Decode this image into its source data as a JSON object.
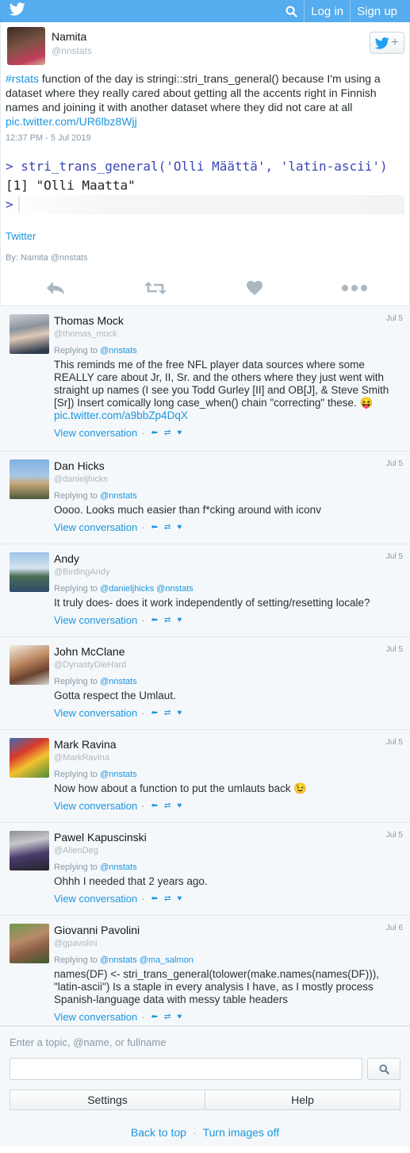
{
  "topbar": {
    "logo_icon": "twitter-bird-icon",
    "search_icon": "search-icon",
    "login_label": "Log in",
    "signup_label": "Sign up"
  },
  "tweet": {
    "author_name": "Namita",
    "author_handle": "@nnstats",
    "text_hashtag": "#rstats",
    "text_body": " function of the day is stringi::stri_trans_general() because I'm using a dataset where they really cared about getting all the accents right in Finnish names and joining it with another dataset where they did not care at all ",
    "text_link": "pic.twitter.com/UR6lbz8Wjj",
    "time": "12:37 PM - 5 Jul 2019",
    "code_lines": [
      "> stri_trans_general('Olli Määttä', 'latin-ascii')",
      "[1] \"Olli Maatta\"",
      ">"
    ],
    "source_link": "Twitter",
    "by_prefix": "By: ",
    "by_name": "Namita",
    "by_handle": "@nnstats"
  },
  "replies": [
    {
      "name": "Thomas Mock",
      "handle": "@thomas_mock",
      "date": "Jul 5",
      "replying_prefix": "Replying to ",
      "replying_to": "@nnstats",
      "text": "This reminds me of the free NFL player data sources where some REALLY care about Jr, II, Sr. and the others where they just went with straight up names (I see you Todd Gurley [II] and OB[J], & Steve Smith [Sr]) Insert comically long case_when() chain \"correcting\" these. 😝",
      "link": "pic.twitter.com/a9bbZp4DqX",
      "view_conversation": "View conversation"
    },
    {
      "name": "Dan Hicks",
      "handle": "@danieljhicks",
      "date": "Jul 5",
      "replying_prefix": "Replying to ",
      "replying_to": "@nnstats",
      "text": "Oooo. Looks much easier than f*cking around with iconv",
      "link": "",
      "view_conversation": "View conversation"
    },
    {
      "name": "Andy",
      "handle": "@BirdingAndy",
      "date": "Jul 5",
      "replying_prefix": "Replying to ",
      "replying_to": "@danieljhicks @nnstats",
      "text": "It truly does- does it work independently of setting/resetting locale?",
      "link": "",
      "view_conversation": "View conversation"
    },
    {
      "name": "John McClane",
      "handle": "@DynastyDieHard",
      "date": "Jul 5",
      "replying_prefix": "Replying to ",
      "replying_to": "@nnstats",
      "text": "Gotta respect the Umlaut.",
      "link": "",
      "view_conversation": "View conversation"
    },
    {
      "name": "Mark Ravina",
      "handle": "@MarkRavina",
      "date": "Jul 5",
      "replying_prefix": "Replying to ",
      "replying_to": "@nnstats",
      "text": "Now how about a function to put the umlauts back 😉",
      "link": "",
      "view_conversation": "View conversation"
    },
    {
      "name": "Pawel Kapuscinski",
      "handle": "@AlienDeg",
      "date": "Jul 5",
      "replying_prefix": "Replying to ",
      "replying_to": "@nnstats",
      "text": "Ohhh I needed that 2 years ago.",
      "link": "",
      "view_conversation": "View conversation"
    },
    {
      "name": "Giovanni Pavolini",
      "handle": "@gpavolini",
      "date": "Jul 6",
      "replying_prefix": "Replying to ",
      "replying_to": "@nnstats @ma_salmon",
      "text": "names(DF) <- stri_trans_general(tolower(make.names(names(DF))), \"latin-ascii\") Is a staple in every analysis I have, as I mostly process Spanish-language data with messy table headers",
      "link": "",
      "view_conversation": "View conversation"
    }
  ],
  "footer": {
    "search_label": "Enter a topic, @name, or fullname",
    "search_value": "",
    "settings_label": "Settings",
    "help_label": "Help",
    "back_to_top": "Back to top",
    "separator": "·",
    "turn_images_off": "Turn images off"
  },
  "colors": {
    "brand": "#55acee",
    "link": "#1b95e0",
    "code_prompt": "#3b47b5"
  }
}
